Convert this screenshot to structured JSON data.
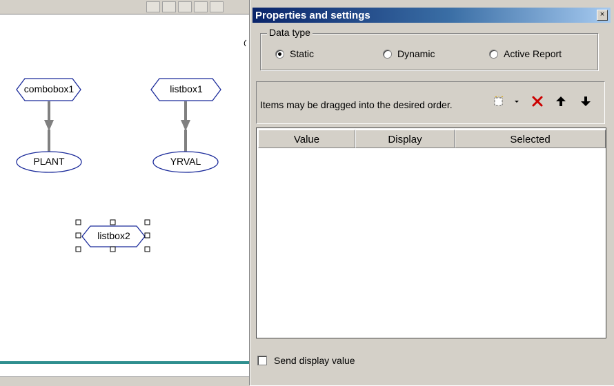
{
  "canvas": {
    "nodes": {
      "combobox1": "combobox1",
      "listbox1": "listbox1",
      "plant": "PLANT",
      "yrval": "YRVAL",
      "listbox2": "listbox2"
    }
  },
  "panel": {
    "title": "Properties and settings",
    "close_glyph": "×",
    "data_type": {
      "legend": "Data type",
      "options": [
        "Static",
        "Dynamic",
        "Active Report"
      ],
      "selected": "Static"
    },
    "items_hint": "Items may be dragged into the desired order.",
    "toolbar_icons": [
      "new-item-icon",
      "dropdown-arrow-icon",
      "delete-icon",
      "move-up-icon",
      "move-down-icon"
    ],
    "grid": {
      "columns": [
        "Value",
        "Display",
        "Selected"
      ],
      "rows": []
    },
    "send_display": {
      "label": "Send display value",
      "checked": false
    }
  },
  "colors": {
    "title_bar_start": "#0a246a",
    "title_bar_end": "#a6caf0",
    "node_outline": "#1a2a9a",
    "connector": "#808080",
    "teal_rule": "#2f8f8f",
    "delete_red": "#cc0000"
  }
}
